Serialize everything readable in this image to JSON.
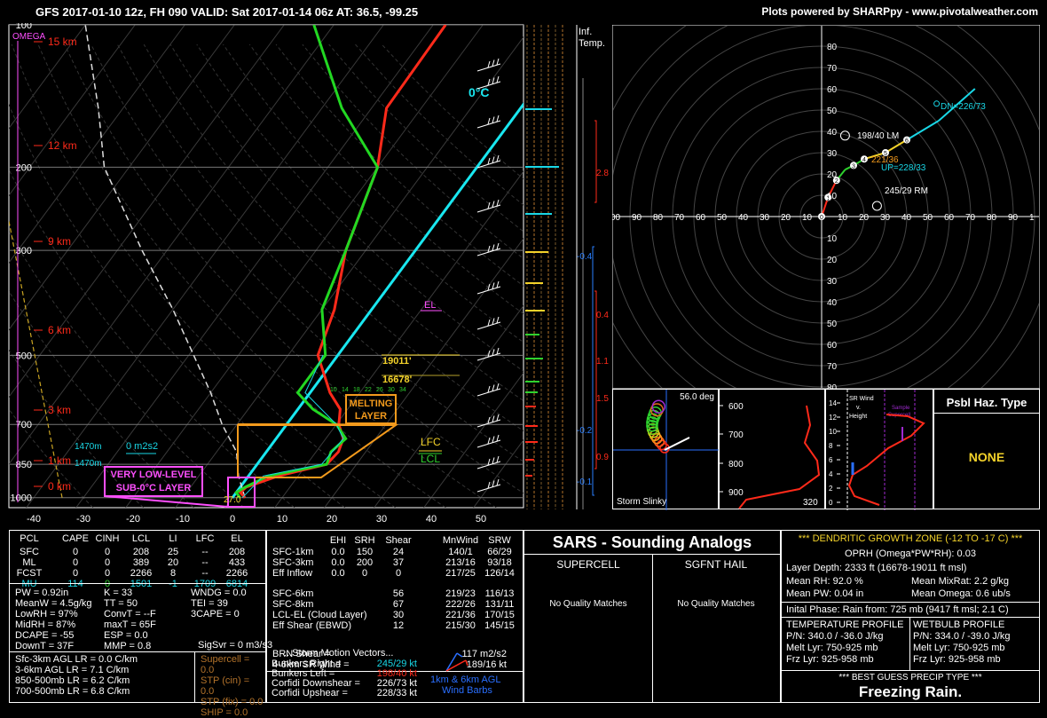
{
  "header": {
    "left": "GFS 2017-01-10 12z, FH 090    VALID: Sat 2017-01-14 06z    AT: 36.5, -99.25",
    "right": "Plots powered by SHARPpy - www.pivotalweather.com"
  },
  "chart_data": [
    {
      "type": "skew-t",
      "title": "",
      "pressure_ticks": [
        "100",
        "200",
        "300",
        "500",
        "700",
        "850",
        "1000"
      ],
      "height_labels": [
        "15 km",
        "12 km",
        "9 km",
        "6 km",
        "3 km",
        "1 km",
        "0 km"
      ],
      "temp_ticks": [
        "-40",
        "-30",
        "-20",
        "-10",
        "0",
        "10",
        "20",
        "30",
        "40",
        "50"
      ],
      "omega_label": "OMEGA",
      "zero_c_label": "0°C",
      "series": [
        {
          "name": "temperature",
          "color": "#ff2a1a",
          "points": [
            [
              100,
              -27.5
            ],
            [
              150,
              -27
            ],
            [
              200,
              -20
            ],
            [
              300,
              -14
            ],
            [
              400,
              -7.5
            ],
            [
              500,
              -4
            ],
            [
              600,
              4
            ],
            [
              650,
              8.5
            ],
            [
              700,
              10.5
            ],
            [
              750,
              13.5
            ],
            [
              800,
              14.5
            ],
            [
              850,
              14
            ],
            [
              900,
              6
            ],
            [
              950,
              1.2
            ],
            [
              975,
              0.8
            ],
            [
              1000,
              2.5
            ]
          ]
        },
        {
          "name": "dewpoint",
          "color": "#22d822",
          "points": [
            [
              100,
              -54
            ],
            [
              150,
              -36
            ],
            [
              200,
              -20
            ],
            [
              300,
              -14
            ],
            [
              400,
              -10
            ],
            [
              500,
              -2.5
            ],
            [
              600,
              -2.5
            ],
            [
              650,
              3
            ],
            [
              700,
              10
            ],
            [
              750,
              14
            ],
            [
              800,
              13
            ],
            [
              850,
              14
            ],
            [
              900,
              4
            ],
            [
              950,
              1
            ],
            [
              975,
              0
            ],
            [
              1000,
              1.5
            ]
          ]
        }
      ],
      "annotations": {
        "el": "EL",
        "lfc": "LFC",
        "lcl": "LCL",
        "melting_layer": "MELTING LAYER",
        "sub_zero_layer": "VERY LOW-LEVEL SUB-0°C LAYER",
        "dgz_top": "19011'",
        "dgz_bottom": "16678'",
        "h1470a": "1470m",
        "h1470b": "1470m",
        "m2s2": "0 m2s2",
        "sfc_temp": "27.0",
        "mix_ratio_ticks": [
          "10",
          "14",
          "18",
          "22",
          "26",
          "30",
          "34"
        ]
      }
    },
    {
      "type": "hodograph",
      "ring_labels": [
        "10",
        "20",
        "30",
        "40",
        "50",
        "60",
        "70",
        "80"
      ],
      "x_labels_left": [
        "00",
        "90",
        "80",
        "70",
        "60",
        "50",
        "40",
        "30",
        "20",
        "10"
      ],
      "x_labels_right": [
        "10",
        "20",
        "30",
        "40",
        "50",
        "60",
        "70",
        "80",
        "90",
        "1"
      ],
      "labels": {
        "lm": "198/40 LM",
        "l1": "221/36",
        "up": "UP=228/33",
        "rm": "245/29 RM",
        "dn": "DN=226/73"
      },
      "points": [
        [
          0,
          -1
        ],
        [
          0,
          0
        ],
        [
          3,
          9
        ],
        [
          7,
          17
        ],
        [
          11,
          22
        ],
        [
          15,
          24
        ],
        [
          20,
          27
        ],
        [
          30,
          30
        ],
        [
          40,
          36
        ],
        [
          55,
          45
        ],
        [
          72,
          60
        ]
      ]
    }
  ],
  "inflection": {
    "title1": "Inf.",
    "title2": "Temp.",
    "values": [
      "2.8",
      "-0.4",
      "0.4",
      "1.1",
      "1.5",
      "-0.2",
      "0.9",
      "-0.1"
    ]
  },
  "storm_slinky": {
    "deg": "56.0 deg",
    "label": "Storm Slinky"
  },
  "theta_panel": {
    "labels": [
      "600",
      "700",
      "800",
      "900"
    ],
    "bottom": "320"
  },
  "sr_wind": {
    "title1": "SR Wind",
    "title2": "v.",
    "title3": "Height",
    "legend": "Sample Supercell",
    "ticks": [
      "14",
      "12",
      "10",
      "8",
      "6",
      "4",
      "2",
      "0"
    ]
  },
  "hazard": {
    "title": "Psbl Haz. Type",
    "value": "NONE"
  },
  "parcels": {
    "headers": [
      "PCL",
      "CAPE",
      "CINH",
      "LCL",
      "LI",
      "LFC",
      "EL"
    ],
    "rows": [
      [
        "SFC",
        "0",
        "0",
        "208",
        "25",
        "--",
        "208"
      ],
      [
        "ML",
        "0",
        "0",
        "389",
        "20",
        "--",
        "433"
      ],
      [
        "FCST",
        "0",
        "0",
        "2266",
        "8",
        "--",
        "2266"
      ],
      [
        "MU",
        "114",
        "0",
        "1501",
        "-1",
        "1709",
        "6814"
      ]
    ]
  },
  "indices": {
    "col1": [
      "PW = 0.92in",
      "MeanW = 4.5g/kg",
      "LowRH = 97%",
      "MidRH = 87%",
      "DCAPE = -55",
      "DownT = 37F"
    ],
    "col2": [
      "K = 33",
      "TT = 50",
      "ConvT = --F",
      "maxT = 65F",
      "ESP = 0.0",
      "MMP = 0.8"
    ],
    "col3": [
      "WNDG = 0.0",
      "TEI = 39",
      "3CAPE = 0",
      "",
      "",
      ""
    ],
    "sigsvr": "SigSvr = 0 m3/s3",
    "lapse": [
      "Sfc-3km AGL LR = 0.0 C/km",
      "3-6km AGL LR = 7.1 C/km",
      "850-500mb LR = 6.2 C/km",
      "700-500mb LR = 6.8 C/km"
    ],
    "stp": [
      "Supercell = 0.0",
      "STP (cin) = 0.0",
      "STP (fix) = 0.0",
      "SHIP = 0.0"
    ]
  },
  "kinematics": {
    "headers": [
      "EHI",
      "SRH",
      "Shear",
      "MnWind",
      "SRW"
    ],
    "rows": [
      [
        "SFC-1km",
        "0.0",
        "150",
        "24",
        "140/1",
        "66/29"
      ],
      [
        "SFC-3km",
        "0.0",
        "200",
        "37",
        "213/16",
        "93/18"
      ],
      [
        "Eff Inflow",
        "0.0",
        "0",
        "0",
        "217/25",
        "126/14"
      ],
      [
        "",
        "",
        "",
        "",
        "",
        ""
      ],
      [
        "SFC-6km",
        "",
        "",
        "56",
        "219/23",
        "116/13"
      ],
      [
        "SFC-8km",
        "",
        "",
        "67",
        "222/26",
        "131/11"
      ],
      [
        "LCL-EL (Cloud Layer)",
        "",
        "",
        "30",
        "221/36",
        "170/15"
      ],
      [
        "Eff Shear (EBWD)",
        "",
        "",
        "12",
        "215/30",
        "145/15"
      ]
    ],
    "brn": [
      "BRN Shear =",
      "117 m2/s2"
    ],
    "srwind46": [
      "4-6km SR Wind =",
      "189/16 kt"
    ],
    "motion_title": "...Storm Motion Vectors...",
    "motion": [
      [
        "Bunkers Right =",
        "245/29 kt"
      ],
      [
        "Bunkers Left =",
        "198/40 kt"
      ],
      [
        "Corfidi Downshear =",
        "226/73 kt"
      ],
      [
        "Corfidi Upshear =",
        "228/33 kt"
      ]
    ],
    "barbs_label1": "1km & 6km AGL",
    "barbs_label2": "Wind Barbs"
  },
  "sars": {
    "title": "SARS - Sounding Analogs",
    "supercell": "SUPERCELL",
    "hail": "SGFNT HAIL",
    "supercell_val": "No Quality Matches",
    "hail_val": "No Quality Matches"
  },
  "dgz": {
    "title": "*** DENDRITIC GROWTH ZONE (-12 TO -17 C) ***",
    "oprh": "OPRH (Omega*PW*RH): 0.03",
    "depth": "Layer Depth: 2333 ft (16678-19011 ft msl)",
    "rh": "Mean RH: 92.0 %",
    "mixrat": "Mean MixRat: 2.2 g/kg",
    "pw": "Mean PW: 0.04 in",
    "omega": "Mean Omega: 0.6 ub/s",
    "phase": "Inital Phase: Rain from: 725 mb (9417 ft msl; 2.1 C)"
  },
  "temp_profile": {
    "title": "TEMPERATURE PROFILE",
    "pn": "P/N: 340.0 / -36.0 J/kg",
    "melt": "Melt Lyr: 750-925 mb",
    "frz": "Frz Lyr: 925-958 mb"
  },
  "wetbulb_profile": {
    "title": "WETBULB PROFILE",
    "pn": "P/N: 334.0 / -39.0 J/kg",
    "melt": "Melt Lyr: 750-925 mb",
    "frz": "Frz Lyr: 925-958 mb"
  },
  "precip": {
    "title": "*** BEST GUESS PRECIP TYPE ***",
    "value": "Freezing Rain."
  }
}
